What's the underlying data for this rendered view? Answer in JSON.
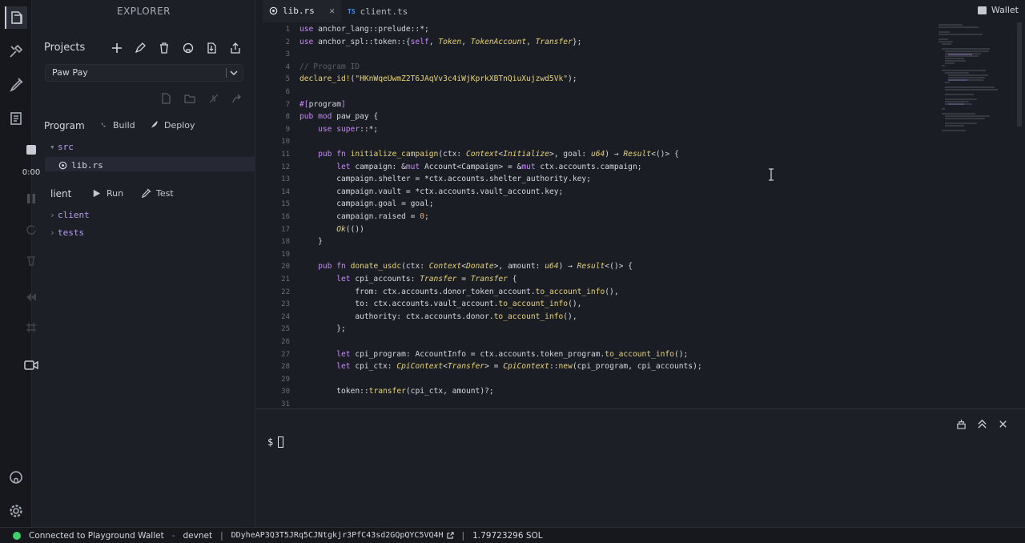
{
  "sidebar": {
    "title": "EXPLORER",
    "projects_label": "Projects",
    "project_name": "Paw Pay",
    "program_label": "Program",
    "build_label": "Build",
    "deploy_label": "Deploy",
    "client_label": "lient",
    "run_label": "Run",
    "test_label": "Test",
    "tree": {
      "src": "src",
      "lib": "lib.rs",
      "client": "client",
      "tests": "tests"
    }
  },
  "recording": {
    "time": "0:00"
  },
  "tabs": [
    {
      "label": "lib.rs",
      "active": true
    },
    {
      "label": "client.ts",
      "active": false,
      "prefix": "TS"
    }
  ],
  "wallet_label": "Wallet",
  "editor": {
    "lines": [
      {
        "n": "1",
        "c": "use anchor_lang::prelude::*;"
      },
      {
        "n": "2",
        "c": "use anchor_spl::token::{self, Token, TokenAccount, Transfer};"
      },
      {
        "n": "3",
        "c": ""
      },
      {
        "n": "4",
        "c": "// Program ID"
      },
      {
        "n": "5",
        "c": "declare_id!(\"HKnWqeUwmZ2T6JAqVv3c4iWjKprkXBTnQiuXujzwd5Vk\");"
      },
      {
        "n": "6",
        "c": ""
      },
      {
        "n": "7",
        "c": "#[program]"
      },
      {
        "n": "8",
        "c": "pub mod paw_pay {"
      },
      {
        "n": "9",
        "c": "    use super::*;"
      },
      {
        "n": "10",
        "c": ""
      },
      {
        "n": "11",
        "c": "    pub fn initialize_campaign(ctx: Context<Initialize>, goal: u64) → Result<()> {"
      },
      {
        "n": "12",
        "c": "        let campaign: &mut Account<Campaign> = &mut ctx.accounts.campaign;"
      },
      {
        "n": "13",
        "c": "        campaign.shelter = *ctx.accounts.shelter_authority.key;"
      },
      {
        "n": "14",
        "c": "        campaign.vault = *ctx.accounts.vault_account.key;"
      },
      {
        "n": "15",
        "c": "        campaign.goal = goal;"
      },
      {
        "n": "16",
        "c": "        campaign.raised = 0;"
      },
      {
        "n": "17",
        "c": "        Ok(())"
      },
      {
        "n": "18",
        "c": "    }"
      },
      {
        "n": "19",
        "c": ""
      },
      {
        "n": "20",
        "c": "    pub fn donate_usdc(ctx: Context<Donate>, amount: u64) → Result<()> {"
      },
      {
        "n": "21",
        "c": "        let cpi_accounts: Transfer = Transfer {"
      },
      {
        "n": "22",
        "c": "            from: ctx.accounts.donor_token_account.to_account_info(),"
      },
      {
        "n": "23",
        "c": "            to: ctx.accounts.vault_account.to_account_info(),"
      },
      {
        "n": "24",
        "c": "            authority: ctx.accounts.donor.to_account_info(),"
      },
      {
        "n": "25",
        "c": "        };"
      },
      {
        "n": "26",
        "c": ""
      },
      {
        "n": "27",
        "c": "        let cpi_program: AccountInfo = ctx.accounts.token_program.to_account_info();"
      },
      {
        "n": "28",
        "c": "        let cpi_ctx: CpiContext<Transfer> = CpiContext::new(cpi_program, cpi_accounts);"
      },
      {
        "n": "29",
        "c": ""
      },
      {
        "n": "30",
        "c": "        token::transfer(cpi_ctx, amount)?;"
      },
      {
        "n": "31",
        "c": ""
      }
    ]
  },
  "terminal": {
    "prompt": "$"
  },
  "status": {
    "connection": "Connected to Playground Wallet",
    "dash": "-",
    "network": "devnet",
    "sep": "|",
    "address": "DDyheAP3Q3T5JRq5CJNtgkjr3PfC43sd2GQpQYC5VQ4H",
    "balance": "1.79723296 SOL"
  },
  "colors": {
    "accent_green": "#3dd26e",
    "keyword": "#c58af5",
    "function": "#e6d37a"
  }
}
